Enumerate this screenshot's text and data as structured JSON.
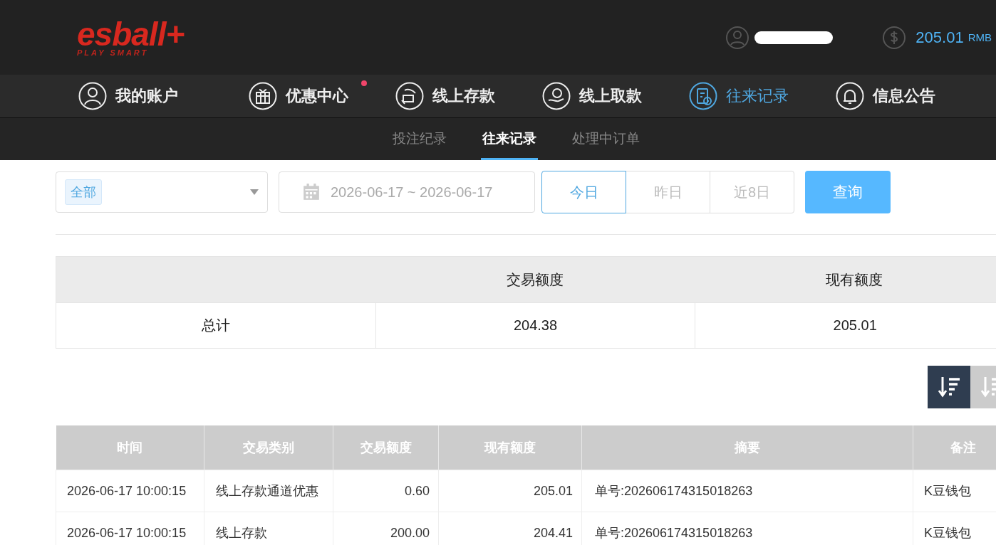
{
  "header": {
    "logo": {
      "brand": "esball+",
      "tagline": "PLAY SMART"
    },
    "balance": {
      "amount": "205.01",
      "currency": "RMB"
    }
  },
  "nav": [
    {
      "label": "我的账户",
      "kind": "user",
      "selected": false,
      "dot": false
    },
    {
      "label": "优惠中心",
      "kind": "gift",
      "selected": false,
      "dot": true
    },
    {
      "label": "线上存款",
      "kind": "deposit",
      "selected": false,
      "dot": false
    },
    {
      "label": "线上取款",
      "kind": "withdraw",
      "selected": false,
      "dot": false
    },
    {
      "label": "往来记录",
      "kind": "record",
      "selected": true,
      "dot": false
    },
    {
      "label": "信息公告",
      "kind": "bell",
      "selected": false,
      "dot": false
    }
  ],
  "subtabs": [
    {
      "label": "投注纪录",
      "selected": false
    },
    {
      "label": "往来记录",
      "selected": true
    },
    {
      "label": "处理中订单",
      "selected": false
    }
  ],
  "filter": {
    "type_tag": "全部",
    "date_range": "2026-06-17 ~ 2026-06-17",
    "periods": [
      {
        "label": "今日",
        "selected": true
      },
      {
        "label": "昨日",
        "selected": false
      },
      {
        "label": "近8日",
        "selected": false
      }
    ],
    "query_button": "查询"
  },
  "summary": {
    "columns": [
      "交易额度",
      "现有额度"
    ],
    "row": {
      "label": "总计",
      "values": [
        "204.38",
        "205.01"
      ]
    }
  },
  "sort_buttons": [
    {
      "selected": true
    },
    {
      "selected": false
    }
  ],
  "table": {
    "columns": [
      "时间",
      "交易类别",
      "交易额度",
      "现有额度",
      "摘要",
      "备注"
    ],
    "rows": [
      [
        "2026-06-17 10:00:15",
        "线上存款通道优惠",
        "0.60",
        "205.01",
        "单号:202606174315018263",
        "K豆钱包"
      ],
      [
        "2026-06-17 10:00:15",
        "线上存款",
        "200.00",
        "204.41",
        "单号:202606174315018263",
        "K豆钱包"
      ]
    ]
  }
}
